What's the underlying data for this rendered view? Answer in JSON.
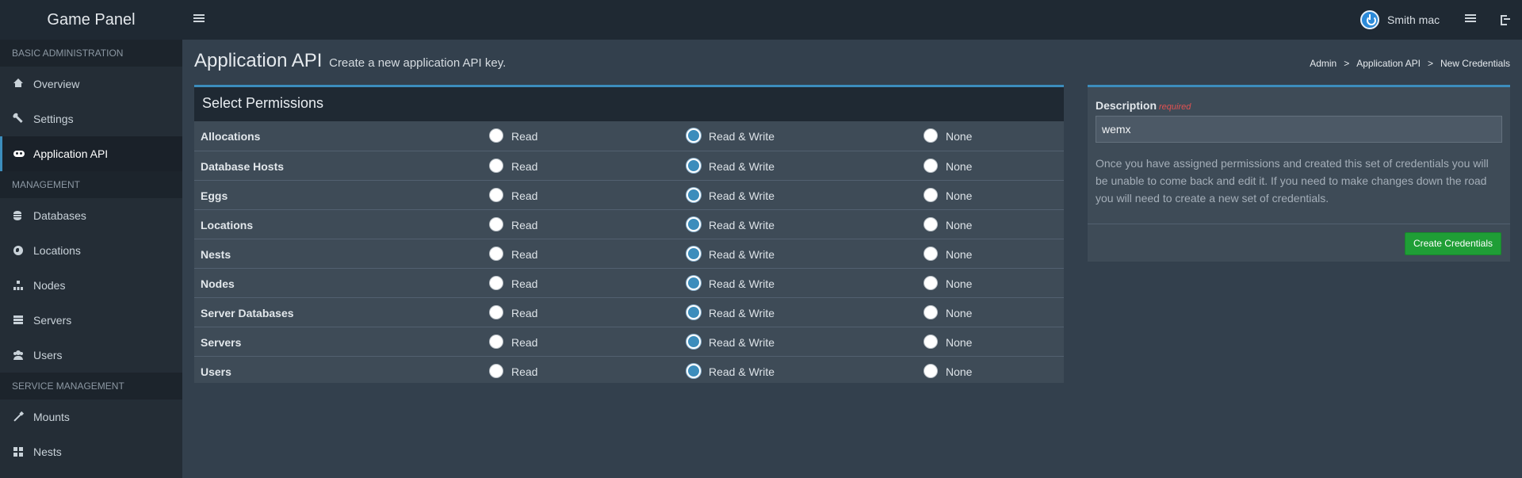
{
  "app": {
    "brand": "Game Panel"
  },
  "header": {
    "user_name": "Smith mac"
  },
  "sidebar": {
    "sections": [
      {
        "title": "BASIC ADMINISTRATION",
        "items": [
          {
            "label": "Overview",
            "icon": "home-icon"
          },
          {
            "label": "Settings",
            "icon": "wrench-icon"
          },
          {
            "label": "Application API",
            "icon": "gamepad-icon",
            "active": true
          }
        ]
      },
      {
        "title": "MANAGEMENT",
        "items": [
          {
            "label": "Databases",
            "icon": "database-icon"
          },
          {
            "label": "Locations",
            "icon": "globe-icon"
          },
          {
            "label": "Nodes",
            "icon": "sitemap-icon"
          },
          {
            "label": "Servers",
            "icon": "server-icon"
          },
          {
            "label": "Users",
            "icon": "users-icon"
          }
        ]
      },
      {
        "title": "SERVICE MANAGEMENT",
        "items": [
          {
            "label": "Mounts",
            "icon": "magic-icon"
          },
          {
            "label": "Nests",
            "icon": "th-icon"
          }
        ]
      }
    ]
  },
  "page": {
    "title": "Application API",
    "subtitle": "Create a new application API key.",
    "breadcrumb": [
      "Admin",
      "Application API",
      "New Credentials"
    ],
    "breadcrumb_separator": ">"
  },
  "permissions": {
    "title": "Select Permissions",
    "option_labels": {
      "read": "Read",
      "read_write": "Read & Write",
      "none": "None"
    },
    "rows": [
      {
        "name": "Allocations",
        "selected": "read_write"
      },
      {
        "name": "Database Hosts",
        "selected": "read_write"
      },
      {
        "name": "Eggs",
        "selected": "read_write"
      },
      {
        "name": "Locations",
        "selected": "read_write"
      },
      {
        "name": "Nests",
        "selected": "read_write"
      },
      {
        "name": "Nodes",
        "selected": "read_write"
      },
      {
        "name": "Server Databases",
        "selected": "read_write"
      },
      {
        "name": "Servers",
        "selected": "read_write"
      },
      {
        "name": "Users",
        "selected": "read_write"
      }
    ]
  },
  "description": {
    "label": "Description",
    "required_label": "required",
    "value": "wemx",
    "help_text": "Once you have assigned permissions and created this set of credentials you will be unable to come back and edit it. If you need to make changes down the road you will need to create a new set of credentials.",
    "submit_label": "Create Credentials"
  },
  "colors": {
    "accent": "#3c8dbc",
    "success": "#1f9e36",
    "required": "#e05252"
  }
}
